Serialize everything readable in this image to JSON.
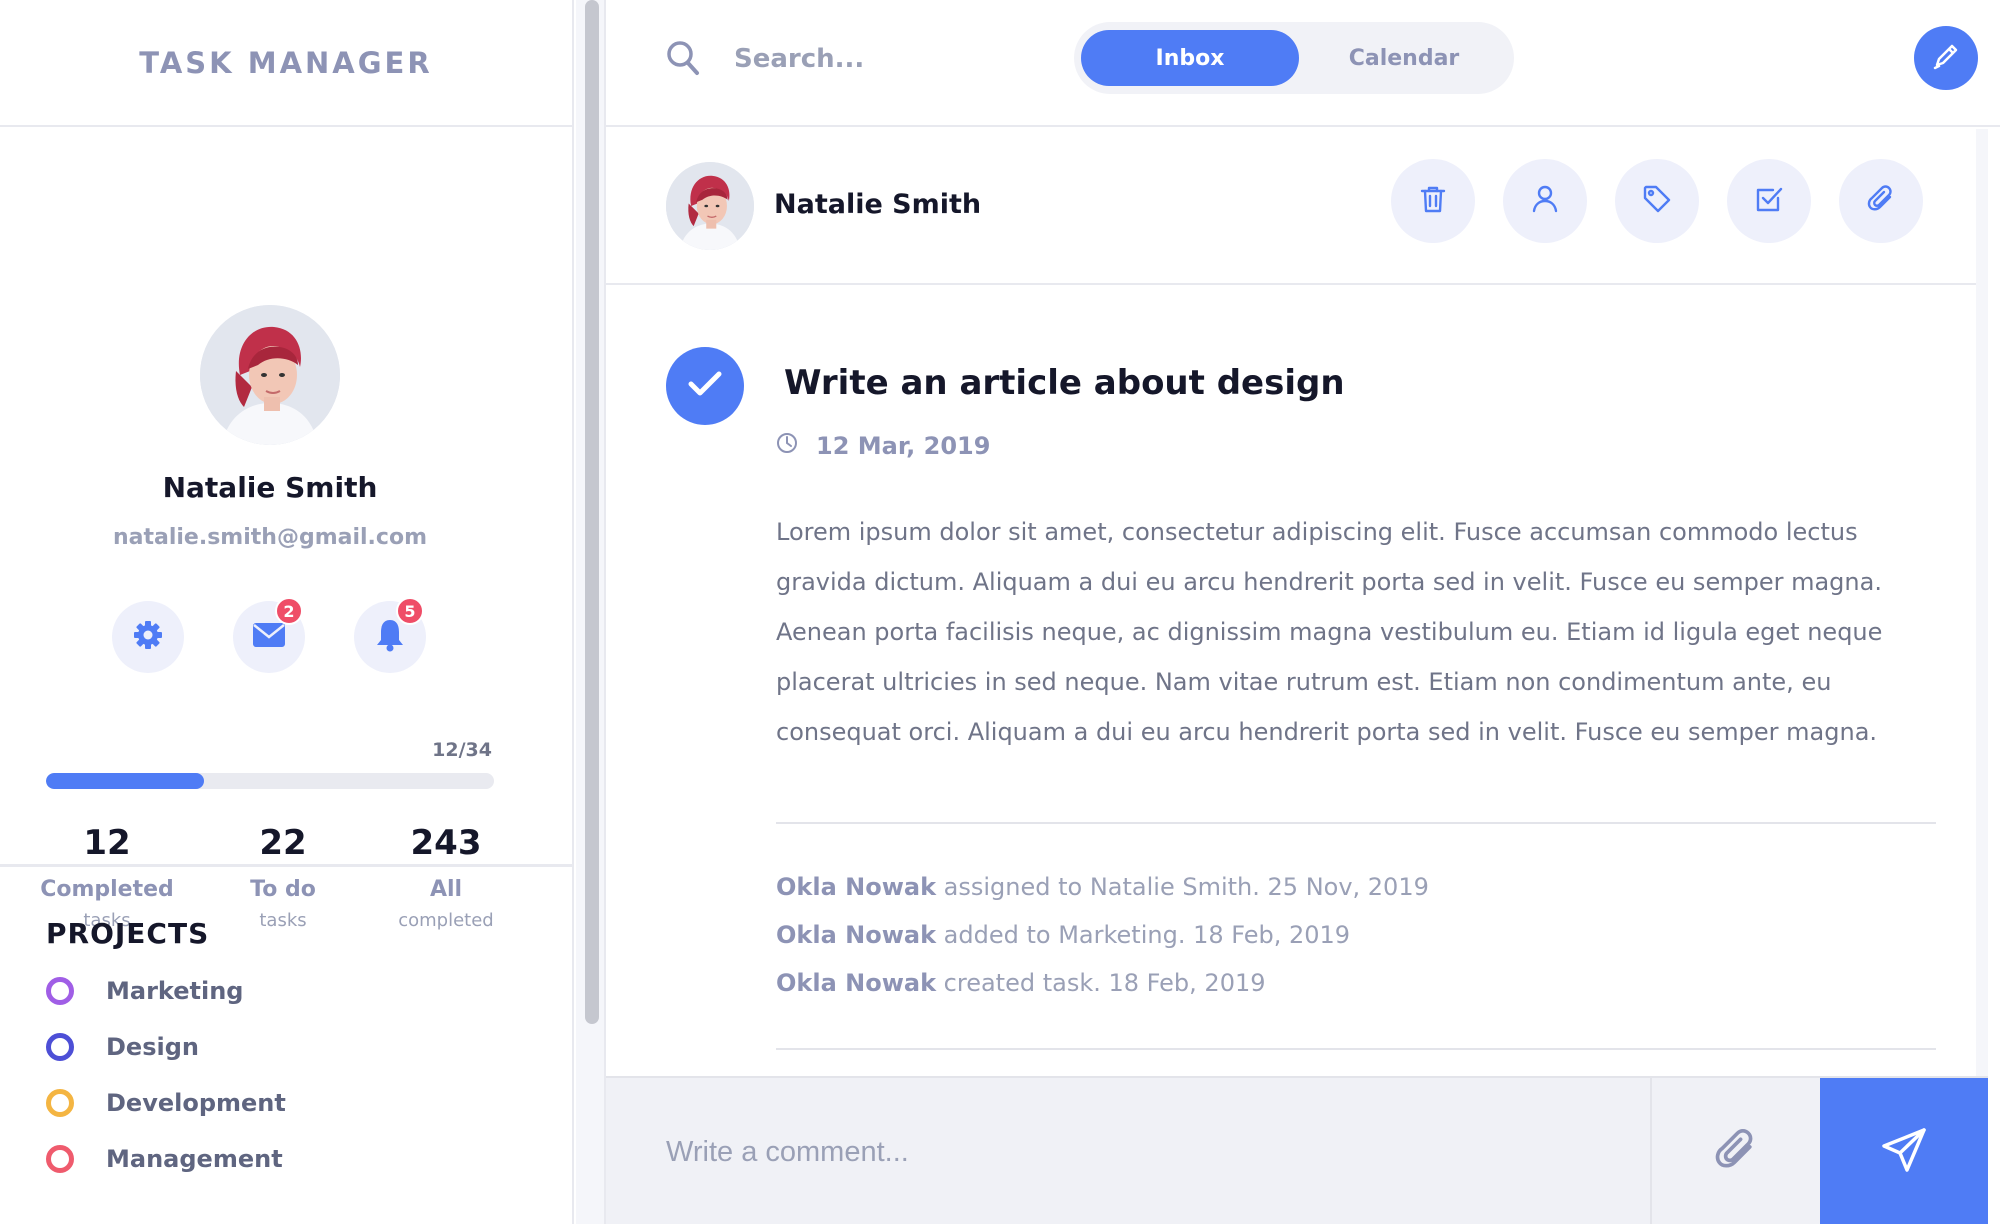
{
  "app": {
    "title": "TASK MANAGER"
  },
  "profile": {
    "name": "Natalie Smith",
    "email": "natalie.smith@gmail.com",
    "messages_badge": "2",
    "notifications_badge": "5",
    "progress_text": "12/34",
    "progress_fraction": 0.353
  },
  "stats": [
    {
      "value": "12",
      "label": "Completed",
      "sub": "tasks"
    },
    {
      "value": "22",
      "label": "To do",
      "sub": "tasks"
    },
    {
      "value": "243",
      "label": "All",
      "sub": "completed"
    }
  ],
  "projects": {
    "title": "PROJECTS",
    "items": [
      {
        "label": "Marketing",
        "color": "#a05ee6"
      },
      {
        "label": "Design",
        "color": "#4d4fd6"
      },
      {
        "label": "Development",
        "color": "#f4b542"
      },
      {
        "label": "Management",
        "color": "#ef5b6d"
      }
    ]
  },
  "topbar": {
    "search_placeholder": "Search...",
    "tabs": [
      {
        "label": "Inbox"
      },
      {
        "label": "Calendar"
      }
    ]
  },
  "task": {
    "assignee": "Natalie Smith",
    "title": "Write an article about design",
    "date": "12 Mar, 2019",
    "body": "Lorem ipsum dolor sit amet, consectetur adipiscing elit. Fusce accumsan commodo lectus gravida dictum. Aliquam a dui eu arcu hendrerit porta sed in velit. Fusce eu semper magna. Aenean porta facilisis neque, ac dignissim magna vestibulum eu. Etiam id ligula eget neque placerat ultricies in sed neque. Nam vitae rutrum est. Etiam non condimentum ante, eu consequat orci. Aliquam a dui eu arcu hendrerit porta sed in velit. Fusce eu semper magna.",
    "activity": [
      {
        "user": "Okla Nowak",
        "text": " assigned to Natalie Smith. 25 Nov, 2019"
      },
      {
        "user": "Okla Nowak",
        "text": " added to Marketing. 18 Feb, 2019"
      },
      {
        "user": "Okla Nowak",
        "text": " created task. 18 Feb, 2019"
      }
    ]
  },
  "comment": {
    "placeholder": "Write a comment..."
  },
  "colors": {
    "accent": "#4f7cf5",
    "badge": "#ef4d67",
    "soft_bg": "#eef0fb"
  },
  "icons": [
    "search-icon",
    "gear-icon",
    "mail-icon",
    "bell-icon",
    "pen-icon",
    "trash-icon",
    "user-icon",
    "tag-icon",
    "checkbox-icon",
    "paperclip-icon",
    "check-icon",
    "clock-icon",
    "send-icon"
  ]
}
